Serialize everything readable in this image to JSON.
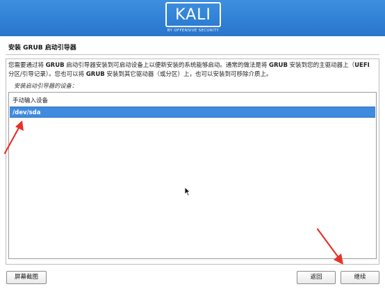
{
  "header": {
    "logo_text": "KALI",
    "logo_subtitle": "BY OFFENSIVE SECURITY"
  },
  "page": {
    "title": "安装 GRUB 启动引导器"
  },
  "description": {
    "seg1": "您需要通过将 ",
    "seg2": "GRUB",
    "seg3": " 启动引导器安装到可启动设备上以便新安装的系统能够启动。通常的做法是将 ",
    "seg4": "GRUB",
    "seg5": " 安装到您的主驱动器上（",
    "seg6": "UEFI",
    "seg7": " 分区/引导记录）。您也可以将 ",
    "seg8": "GRUB",
    "seg9": " 安装到其它驱动器（或分区）上，也可以安装到可移除介质上。"
  },
  "device_list": {
    "label": "安装启动引导器的设备：",
    "items": [
      {
        "label": "手动输入设备",
        "selected": false
      },
      {
        "label": "/dev/sda",
        "selected": true
      }
    ],
    "selected_color": "#3f8be0"
  },
  "buttons": {
    "screenshot": "屏幕截图",
    "back": "返回",
    "continue": "继续"
  },
  "annotation_color": "#e8312a"
}
